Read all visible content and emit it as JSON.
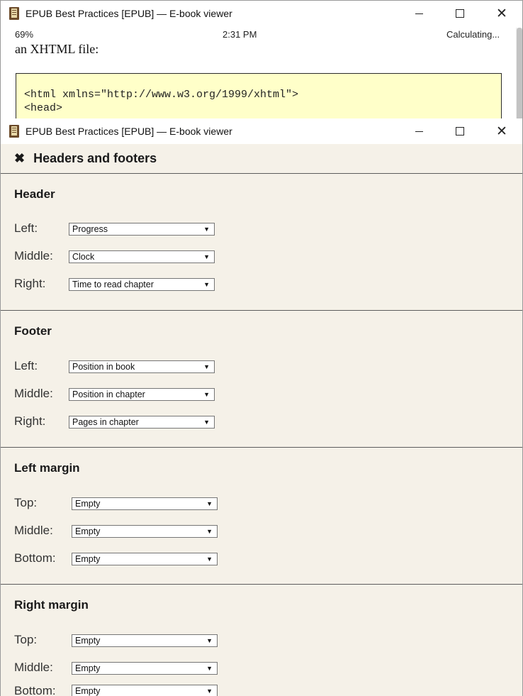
{
  "back_window": {
    "title": "EPUB Best Practices [EPUB] — E-book viewer",
    "status": {
      "left": "69%",
      "middle": "2:31 PM",
      "right": "Calculating..."
    },
    "text": "an XHTML file:",
    "code_lines": [
      "<html xmlns=\"http://www.w3.org/1999/xhtml\">",
      "<head>"
    ]
  },
  "front_window": {
    "title": "EPUB Best Practices [EPUB] — E-book viewer",
    "panel_title": "Headers and footers",
    "sections": [
      {
        "title": "Header",
        "rows": [
          {
            "label": "Left:",
            "value": "Progress"
          },
          {
            "label": "Middle:",
            "value": "Clock"
          },
          {
            "label": "Right:",
            "value": "Time to read chapter"
          }
        ]
      },
      {
        "title": "Footer",
        "rows": [
          {
            "label": "Left:",
            "value": "Position in book"
          },
          {
            "label": "Middle:",
            "value": "Position in chapter"
          },
          {
            "label": "Right:",
            "value": "Pages in chapter"
          }
        ]
      },
      {
        "title": "Left margin",
        "rows": [
          {
            "label": "Top:",
            "value": "Empty"
          },
          {
            "label": "Middle:",
            "value": "Empty"
          },
          {
            "label": "Bottom:",
            "value": "Empty"
          }
        ]
      },
      {
        "title": "Right margin",
        "rows": [
          {
            "label": "Top:",
            "value": "Empty"
          },
          {
            "label": "Middle:",
            "value": "Empty"
          },
          {
            "label": "Bottom:",
            "value": "Empty"
          }
        ]
      }
    ]
  },
  "icons": {
    "app": "book-icon",
    "minimize": "minimize-icon",
    "maximize": "maximize-icon",
    "close": "close-icon",
    "panel_close": "close-x-icon",
    "dropdown": "chevron-down-icon"
  },
  "colors": {
    "panel_bg": "#f5f1e8",
    "code_bg": "#ffffc9"
  }
}
